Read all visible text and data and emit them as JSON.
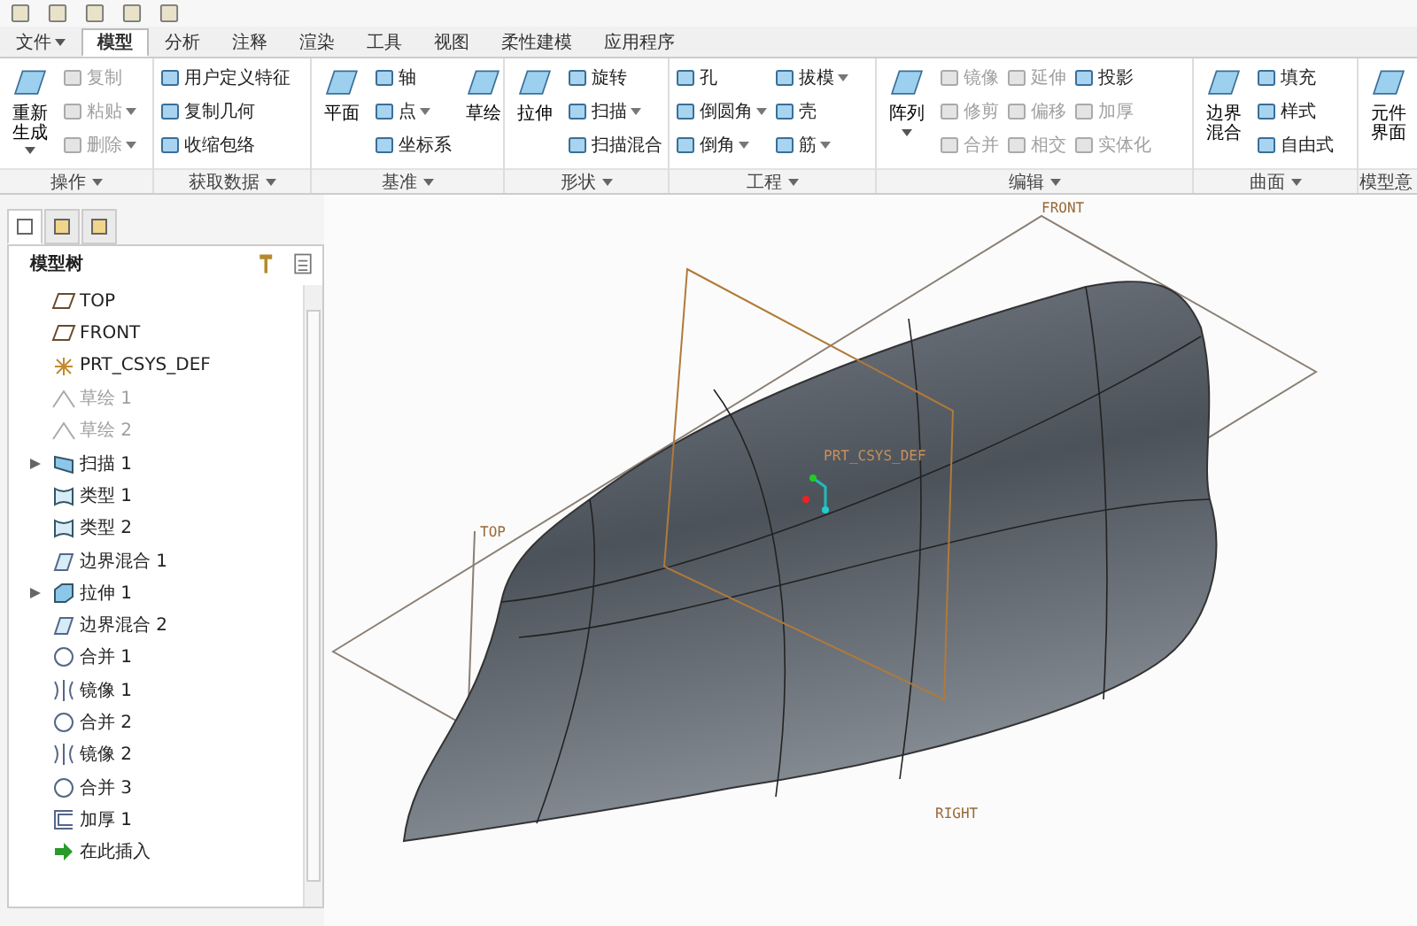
{
  "tabs": [
    {
      "label": "文件",
      "selected": false,
      "menu": true
    },
    {
      "label": "模型",
      "selected": true,
      "menu": false
    },
    {
      "label": "分析",
      "selected": false,
      "menu": false
    },
    {
      "label": "注释",
      "selected": false,
      "menu": false
    },
    {
      "label": "渲染",
      "selected": false,
      "menu": false
    },
    {
      "label": "工具",
      "selected": false,
      "menu": false
    },
    {
      "label": "视图",
      "selected": false,
      "menu": false
    },
    {
      "label": "柔性建模",
      "selected": false,
      "menu": false
    },
    {
      "label": "应用程序",
      "selected": false,
      "menu": false
    }
  ],
  "ribbon": [
    {
      "label": "操作",
      "items": [
        {
          "label": "重新生成",
          "kind": "big",
          "disabled": false,
          "menu": true
        },
        {
          "label": "复制",
          "kind": "small",
          "disabled": true,
          "menu": false
        },
        {
          "label": "粘贴",
          "kind": "small",
          "disabled": true,
          "menu": true
        },
        {
          "label": "删除",
          "kind": "small",
          "disabled": true,
          "menu": true
        }
      ]
    },
    {
      "label": "获取数据",
      "items": [
        {
          "label": "用户定义特征",
          "kind": "small",
          "disabled": false,
          "menu": false
        },
        {
          "label": "复制几何",
          "kind": "small",
          "disabled": false,
          "menu": false
        },
        {
          "label": "收缩包络",
          "kind": "small",
          "disabled": false,
          "menu": false
        }
      ]
    },
    {
      "label": "基准",
      "items": [
        {
          "label": "平面",
          "kind": "big",
          "disabled": false,
          "menu": false
        },
        {
          "label": "轴",
          "kind": "small",
          "disabled": false,
          "menu": false
        },
        {
          "label": "点",
          "kind": "small",
          "disabled": false,
          "menu": true
        },
        {
          "label": "坐标系",
          "kind": "small",
          "disabled": false,
          "menu": false
        },
        {
          "label": "草绘",
          "kind": "big",
          "disabled": false,
          "menu": false
        }
      ]
    },
    {
      "label": "形状",
      "items": [
        {
          "label": "拉伸",
          "kind": "big",
          "disabled": false,
          "menu": false
        },
        {
          "label": "旋转",
          "kind": "small",
          "disabled": false,
          "menu": false
        },
        {
          "label": "扫描",
          "kind": "small",
          "disabled": false,
          "menu": true
        },
        {
          "label": "扫描混合",
          "kind": "small",
          "disabled": false,
          "menu": false
        }
      ]
    },
    {
      "label": "工程",
      "items": [
        {
          "label": "孔",
          "kind": "small",
          "disabled": false,
          "menu": false
        },
        {
          "label": "倒圆角",
          "kind": "small",
          "disabled": false,
          "menu": true
        },
        {
          "label": "倒角",
          "kind": "small",
          "disabled": false,
          "menu": true
        },
        {
          "label": "拔模",
          "kind": "small",
          "disabled": false,
          "menu": true
        },
        {
          "label": "壳",
          "kind": "small",
          "disabled": false,
          "menu": false
        },
        {
          "label": "筋",
          "kind": "small",
          "disabled": false,
          "menu": true
        }
      ]
    },
    {
      "label": "编辑",
      "items": [
        {
          "label": "阵列",
          "kind": "big",
          "disabled": false,
          "menu": true
        },
        {
          "label": "镜像",
          "kind": "small",
          "disabled": true,
          "menu": false
        },
        {
          "label": "修剪",
          "kind": "small",
          "disabled": true,
          "menu": false
        },
        {
          "label": "合并",
          "kind": "small",
          "disabled": true,
          "menu": false
        },
        {
          "label": "延伸",
          "kind": "small",
          "disabled": true,
          "menu": false
        },
        {
          "label": "偏移",
          "kind": "small",
          "disabled": true,
          "menu": false
        },
        {
          "label": "相交",
          "kind": "small",
          "disabled": true,
          "menu": false
        },
        {
          "label": "投影",
          "kind": "small",
          "disabled": false,
          "menu": false
        },
        {
          "label": "加厚",
          "kind": "small",
          "disabled": true,
          "menu": false
        },
        {
          "label": "实体化",
          "kind": "small",
          "disabled": true,
          "menu": false
        }
      ]
    },
    {
      "label": "曲面",
      "items": [
        {
          "label": "边界混合",
          "kind": "big",
          "disabled": false,
          "menu": false
        },
        {
          "label": "填充",
          "kind": "small",
          "disabled": false,
          "menu": false
        },
        {
          "label": "样式",
          "kind": "small",
          "disabled": false,
          "menu": false
        },
        {
          "label": "自由式",
          "kind": "small",
          "disabled": false,
          "menu": false
        }
      ]
    },
    {
      "label": "模型意",
      "items": [
        {
          "label": "元件界面",
          "kind": "big",
          "disabled": false,
          "menu": false
        }
      ]
    }
  ],
  "panel_tabs": [
    {
      "selected": true
    },
    {
      "selected": false
    },
    {
      "selected": false
    }
  ],
  "tree": {
    "title": "模型树",
    "items": [
      {
        "label": "TOP",
        "kind": "plane",
        "disabled": false,
        "expandable": false
      },
      {
        "label": "FRONT",
        "kind": "plane",
        "disabled": false,
        "expandable": false
      },
      {
        "label": "PRT_CSYS_DEF",
        "kind": "csys",
        "disabled": false,
        "expandable": false
      },
      {
        "label": "草绘 1",
        "kind": "sketch",
        "disabled": true,
        "expandable": false
      },
      {
        "label": "草绘 2",
        "kind": "sketch",
        "disabled": true,
        "expandable": false
      },
      {
        "label": "扫描 1",
        "kind": "sweep",
        "disabled": false,
        "expandable": true
      },
      {
        "label": "类型 1",
        "kind": "style",
        "disabled": false,
        "expandable": false
      },
      {
        "label": "类型 2",
        "kind": "style",
        "disabled": false,
        "expandable": false
      },
      {
        "label": "边界混合 1",
        "kind": "boundary",
        "disabled": false,
        "expandable": false
      },
      {
        "label": "拉伸 1",
        "kind": "extrude",
        "disabled": false,
        "expandable": true
      },
      {
        "label": "边界混合 2",
        "kind": "boundary",
        "disabled": false,
        "expandable": false
      },
      {
        "label": "合并 1",
        "kind": "merge",
        "disabled": false,
        "expandable": false
      },
      {
        "label": "镜像 1",
        "kind": "mirror",
        "disabled": false,
        "expandable": false
      },
      {
        "label": "合并 2",
        "kind": "merge",
        "disabled": false,
        "expandable": false
      },
      {
        "label": "镜像 2",
        "kind": "mirror",
        "disabled": false,
        "expandable": false
      },
      {
        "label": "合并 3",
        "kind": "merge",
        "disabled": false,
        "expandable": false
      },
      {
        "label": "加厚 1",
        "kind": "thicken",
        "disabled": false,
        "expandable": false
      },
      {
        "label": "在此插入",
        "kind": "insert",
        "disabled": false,
        "expandable": false
      }
    ]
  },
  "viewport": {
    "labels": [
      {
        "text": "FRONT",
        "kind": "plane"
      },
      {
        "text": "TOP",
        "kind": "plane"
      },
      {
        "text": "RIGHT",
        "kind": "plane"
      },
      {
        "text": "PRT_CSYS_DEF",
        "kind": "csys"
      }
    ]
  }
}
